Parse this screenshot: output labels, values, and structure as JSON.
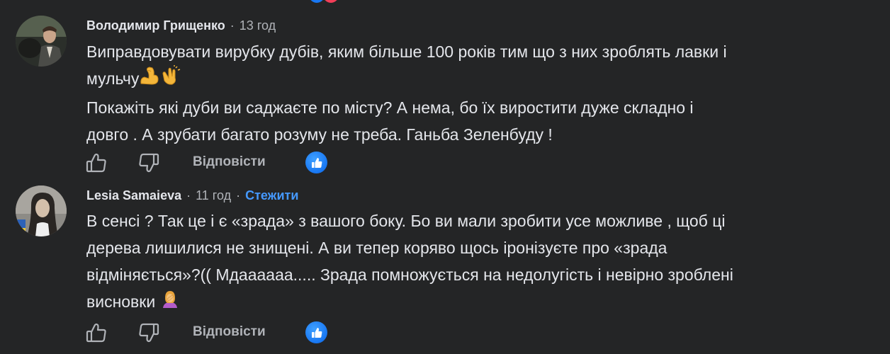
{
  "comments": [
    {
      "author": "Володимир Грищенко",
      "separator": "·",
      "time": "13 год",
      "lines": [
        "Виправдовувати вирубку дубів, яким більше 100 років тим що з них зроблять лавки і",
        "мульчу",
        "Покажіть які дуби ви саджаєте по місту? А нема, бо їх виростити дуже складно і",
        "довго . А зрубати багато розуму не треба. Ганьба Зеленбуду !"
      ],
      "emojis": [
        "flexed-biceps",
        "clapping-hands"
      ],
      "reply_label": "Відповісти"
    },
    {
      "author": "Lesia Samaieva",
      "separator": "·",
      "time": "11 год",
      "separator2": "·",
      "follow_label": "Стежити",
      "lines": [
        "В сенсі ? Так це і є «зрада» з вашого боку. Бо ви мали зробити усе можливе , щоб ці",
        "дерева лишилися не знищені. А ви тепер коряво щось іронізуєте про «зрада",
        "відміняється»?(( Мдаааааа..... Зрада помножується на недолугість і невірно зроблені",
        "висновки"
      ],
      "emojis": [
        "person-facepalming"
      ],
      "reply_label": "Відповісти"
    }
  ],
  "colors": {
    "background": "#242526",
    "text_primary": "#e4e6eb",
    "text_secondary": "#b0b3b8",
    "link": "#4599ff",
    "like_badge": "#1877f2"
  },
  "icons": [
    "thumbs-up-icon",
    "thumbs-down-icon",
    "like-reaction-icon"
  ]
}
